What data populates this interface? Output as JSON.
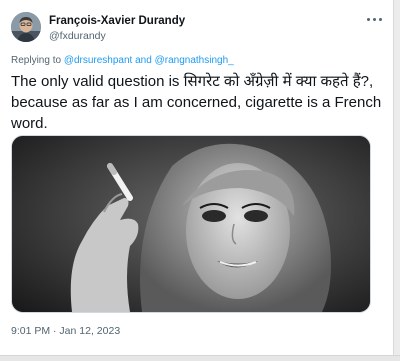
{
  "tweet": {
    "author_name": "François-Xavier Durandy",
    "author_handle": "@fxdurandy",
    "replying_prefix": "Replying to ",
    "replying_user1": "@drsureshpant",
    "replying_joiner": " and ",
    "replying_user2": "@rangnathsingh_",
    "text": "The only valid question is सिगरेट को अँग्रेज़ी में क्या कहते हैं?, because as far as I am concerned, cigarette is a French word.",
    "timestamp": "9:01 PM · Jan 12, 2023"
  },
  "icons": {
    "avatar": "avatar-photo",
    "more": "more-dots-icon"
  },
  "colors": {
    "link": "#1d9bf0",
    "secondary_text": "#536471",
    "primary_text": "#0f1419"
  }
}
